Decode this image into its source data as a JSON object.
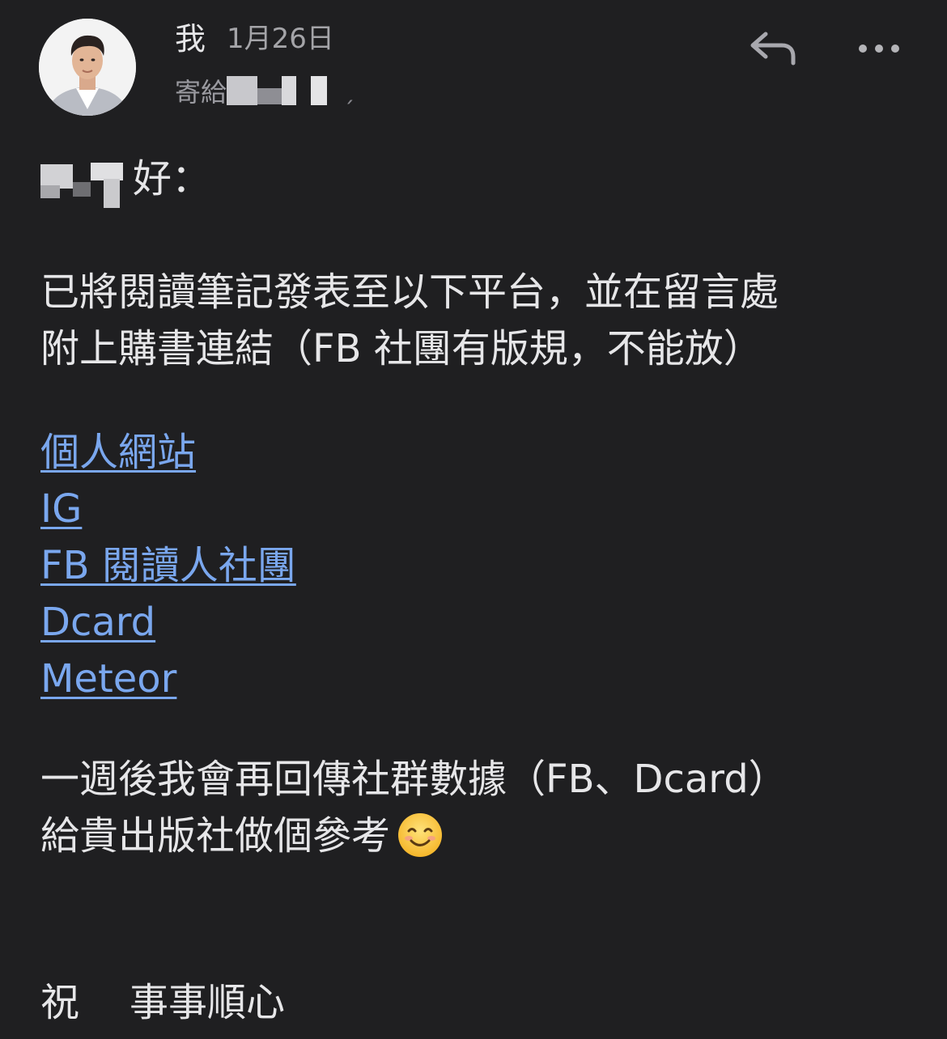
{
  "header": {
    "sender_name": "我",
    "date": "1月26日",
    "recipient_prefix": "寄給",
    "recipient_separator": "ˏ",
    "actions": {
      "reply_icon": "reply-arrow-icon",
      "more_icon": "more-horizontal-icon"
    }
  },
  "message": {
    "greeting_suffix": "好：",
    "paragraph1": [
      "已將閱讀筆記發表至以下平台，並在留言處",
      "附上購書連結（FB 社團有版規，不能放）"
    ],
    "links": [
      {
        "label": "個人網站"
      },
      {
        "label": "IG"
      },
      {
        "label": "FB 閱讀人社團"
      },
      {
        "label": "Dcard"
      },
      {
        "label": "Meteor"
      }
    ],
    "paragraph2": [
      "一週後我會再回傳社群數據（FB、Dcard）",
      "給貴出版社做個參考"
    ],
    "emoji": "smiling-face-icon",
    "closing_word1": "祝",
    "closing_word2": "事事順心"
  },
  "colors": {
    "background": "#1f1f21",
    "text": "#e6e6e8",
    "secondary_text": "#a4a4a8",
    "link": "#7aa7ee"
  }
}
